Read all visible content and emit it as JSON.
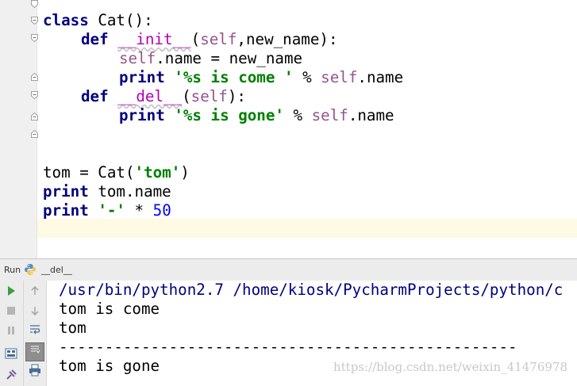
{
  "editor": {
    "code": {
      "l1": {
        "a": "class",
        "b": " Cat():"
      },
      "l2": {
        "a": "def",
        "b": " ",
        "c": "__init__",
        "d": "(",
        "e": "self",
        "f": ",new_name):"
      },
      "l3": {
        "a": "self",
        "b": ".name = new_name"
      },
      "l4": {
        "a": "print",
        "b": " ",
        "c": "'%s is come '",
        "d": " % ",
        "e": "self",
        "f": ".name"
      },
      "l5": {
        "a": "def",
        "b": " ",
        "c": "__del__",
        "d": "(",
        "e": "self",
        "f": "):"
      },
      "l6": {
        "a": "print",
        "b": " ",
        "c": "'%s is gone'",
        "d": " % ",
        "e": "self",
        "f": ".name"
      },
      "l7": {
        "a": "tom = Cat(",
        "b": "'tom'",
        "c": ")"
      },
      "l8": {
        "a": "print",
        "b": " tom.name"
      },
      "l9": {
        "a": "print",
        "b": " ",
        "c": "'-'",
        "d": " * ",
        "e": "50"
      }
    }
  },
  "run_panel": {
    "label": "Run",
    "config_name": "__del__",
    "output": [
      "/usr/bin/python2.7 /home/kiosk/PycharmProjects/python/c",
      "tom is come",
      "tom",
      "--------------------------------------------------",
      "tom is gone"
    ],
    "watermark": "https://blog.csdn.net/weixin_41476978"
  },
  "colors": {
    "keyword": "#000080",
    "self": "#94558d",
    "magic": "#b200b2",
    "string": "#008000",
    "number": "#0000ff",
    "current_line": "#fffae3",
    "gutter": "#f0f0f0"
  }
}
